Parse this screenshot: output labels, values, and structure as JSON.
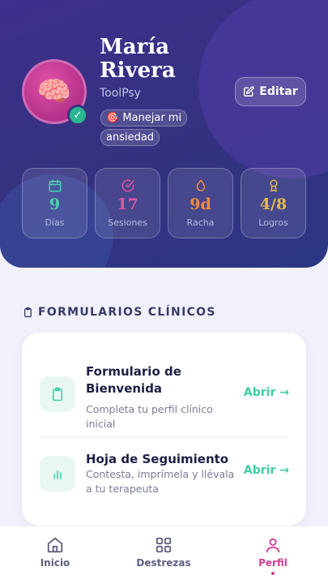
{
  "profile": {
    "name": "María Rivera",
    "app_name": "ToolPsy",
    "goal": "🎯 Manejar mi ansiedad",
    "edit_label": "Editar",
    "avatar_emoji": "🧠",
    "verified_icon": "check-icon"
  },
  "stats": [
    {
      "value": "9",
      "label": "Días",
      "icon": "calendar-icon",
      "color": "#4fd1b0"
    },
    {
      "value": "17",
      "label": "Sesiones",
      "icon": "check-circle-icon",
      "color": "#e255a6"
    },
    {
      "value": "9d",
      "label": "Racha",
      "icon": "flame-icon",
      "color": "#f08b3a"
    },
    {
      "value": "4/8",
      "label": "Logros",
      "icon": "award-icon",
      "color": "#e4b94a"
    }
  ],
  "forms_section": {
    "title": "FORMULARIOS CLÍNICOS",
    "items": [
      {
        "title": "Formulario de Bienvenida",
        "description": "Completa tu perfil clínico inicial",
        "action": "Abrir →",
        "icon": "clipboard-icon"
      },
      {
        "title": "Hoja de Seguimiento",
        "description": "Contesta, imprímela y llévala a tu terapeuta",
        "action": "Abrir →",
        "icon": "bar-chart-icon"
      }
    ]
  },
  "nav": [
    {
      "label": "Inicio",
      "icon": "home-icon"
    },
    {
      "label": "Destrezas",
      "icon": "grid-icon"
    },
    {
      "label": "Perfil",
      "icon": "user-icon",
      "active": true
    }
  ],
  "colors": {
    "accent": "#d43c95",
    "teal": "#3ccca2",
    "hero": "#34327f"
  }
}
